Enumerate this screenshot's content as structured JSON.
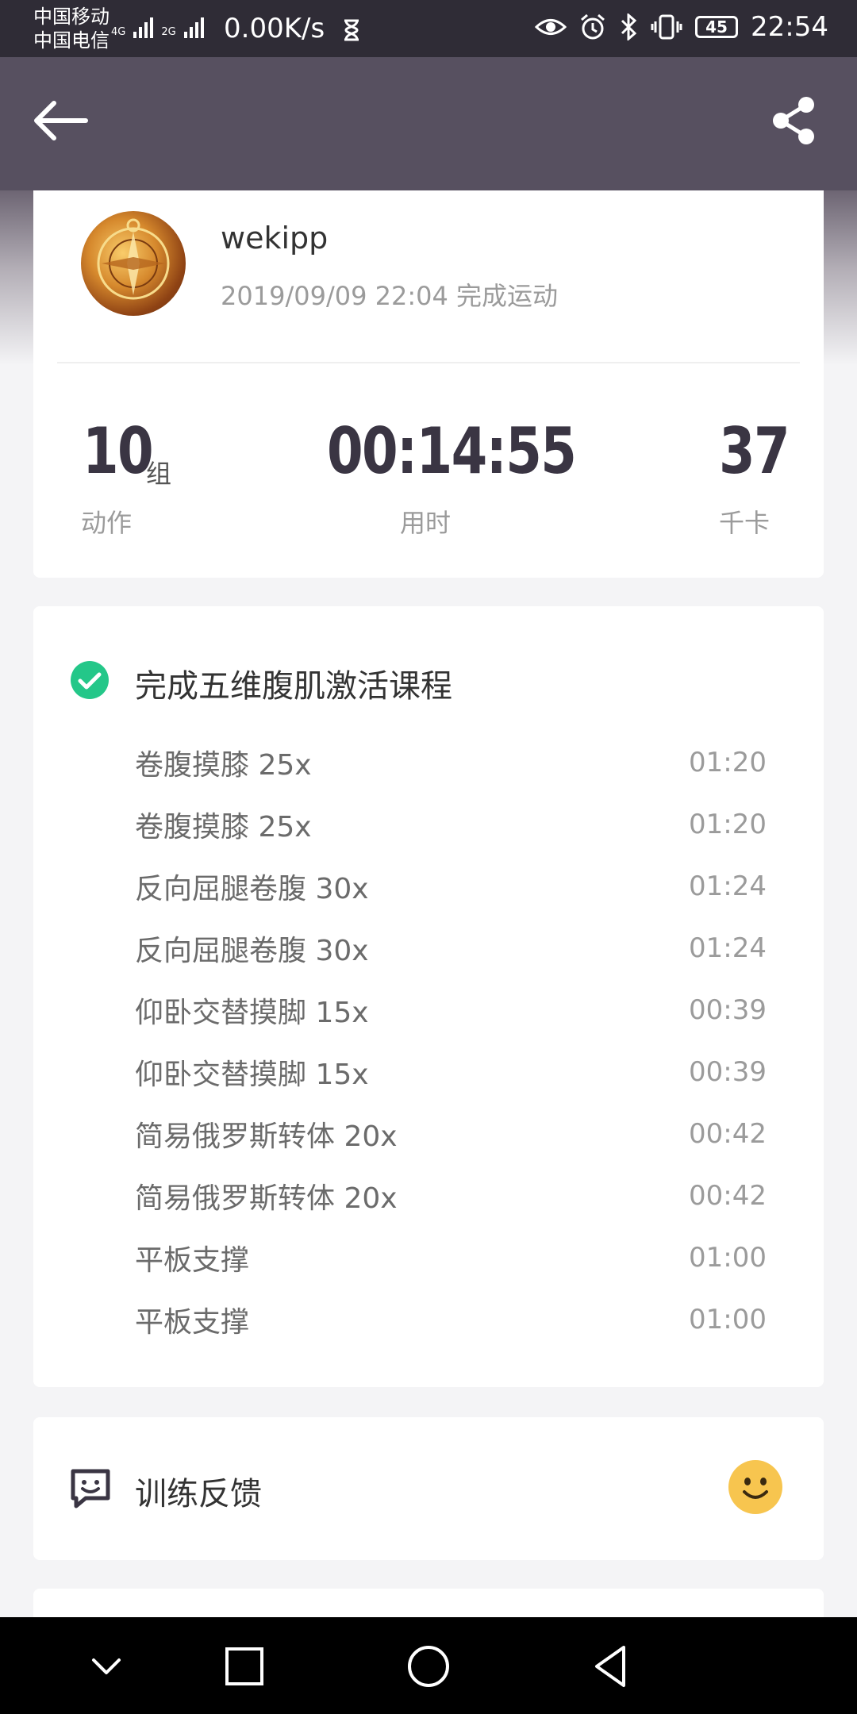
{
  "status_bar": {
    "carrier_1": "中国移动",
    "carrier_2": "中国电信",
    "network_1": "4G",
    "network_2": "2G",
    "speed": "0.00K/s",
    "battery": "45",
    "time": "22:54"
  },
  "profile": {
    "username": "wekipp",
    "finish_text": "2019/09/09 22:04 完成运动"
  },
  "stats": [
    {
      "value": "10",
      "unit": "组",
      "label": "动作"
    },
    {
      "value": "00:14:55",
      "label": "用时"
    },
    {
      "value": "37",
      "label": "千卡"
    }
  ],
  "course": {
    "title": "完成五维腹肌激活课程",
    "exercises": [
      {
        "name": "卷腹摸膝 25x",
        "duration": "01:20"
      },
      {
        "name": "卷腹摸膝 25x",
        "duration": "01:20"
      },
      {
        "name": "反向屈腿卷腹 30x",
        "duration": "01:24"
      },
      {
        "name": "反向屈腿卷腹 30x",
        "duration": "01:24"
      },
      {
        "name": "仰卧交替摸脚 15x",
        "duration": "00:39"
      },
      {
        "name": "仰卧交替摸脚 15x",
        "duration": "00:39"
      },
      {
        "name": "简易俄罗斯转体 20x",
        "duration": "00:42"
      },
      {
        "name": "简易俄罗斯转体 20x",
        "duration": "00:42"
      },
      {
        "name": "平板支撑",
        "duration": "01:00"
      },
      {
        "name": "平板支撑",
        "duration": "01:00"
      }
    ]
  },
  "feedback": {
    "label": "训练反馈"
  },
  "colors": {
    "status_bar": "#2f2c36",
    "app_bar": "#575060",
    "check_green": "#24c789",
    "smiley_yellow": "#f7c54f",
    "stat_text": "#3a3543"
  },
  "icons": {
    "back": "arrow-left-icon",
    "share": "share-icon",
    "check": "check-circle-icon",
    "feedback": "chat-smile-icon",
    "smiley": "smiley-face-icon",
    "nav_back": "triangle-back-icon",
    "nav_home": "circle-home-icon",
    "nav_recents": "square-recents-icon",
    "nav_collapse": "chevron-down-icon"
  }
}
